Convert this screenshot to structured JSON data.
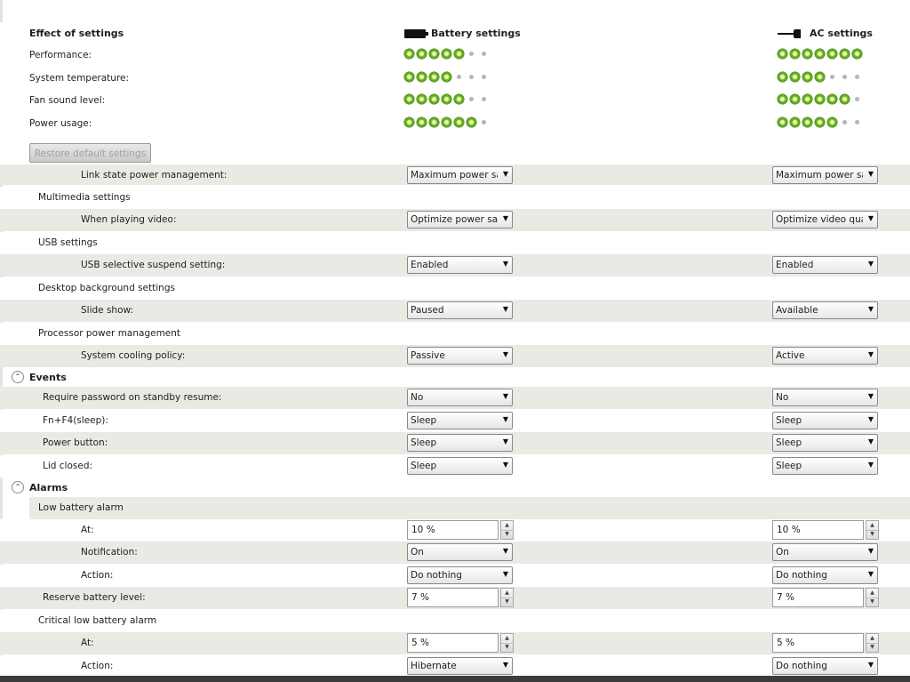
{
  "effect": {
    "title": "Effect of settings",
    "battery_header": "Battery settings",
    "ac_header": "AC settings",
    "rows": [
      {
        "label": "Performance:",
        "battery": {
          "on": 5,
          "total": 7
        },
        "ac": {
          "on": 7,
          "total": 7
        }
      },
      {
        "label": "System temperature:",
        "battery": {
          "on": 4,
          "total": 7
        },
        "ac": {
          "on": 4,
          "total": 7
        }
      },
      {
        "label": "Fan sound level:",
        "battery": {
          "on": 5,
          "total": 7
        },
        "ac": {
          "on": 6,
          "total": 7
        }
      },
      {
        "label": "Power usage:",
        "battery": {
          "on": 6,
          "total": 7
        },
        "ac": {
          "on": 5,
          "total": 7
        }
      }
    ],
    "restore_button": "Restore default settings"
  },
  "list": {
    "partial_row": {
      "label": "Link state power management:",
      "battery": "Maximum power sa",
      "ac": "Maximum power sa"
    },
    "multimedia": {
      "group": "Multimedia settings",
      "item": {
        "label": "When playing video:",
        "battery": "Optimize power sav",
        "ac": "Optimize video qual"
      }
    },
    "usb": {
      "group": "USB settings",
      "item": {
        "label": "USB selective suspend setting:",
        "battery": "Enabled",
        "ac": "Enabled"
      }
    },
    "desktop": {
      "group": "Desktop background settings",
      "item": {
        "label": "Slide show:",
        "battery": "Paused",
        "ac": "Available"
      }
    },
    "processor": {
      "group": "Processor power management",
      "item": {
        "label": "System cooling policy:",
        "battery": "Passive",
        "ac": "Active"
      }
    },
    "events": {
      "title": "Events",
      "items": [
        {
          "label": "Require password on standby resume:",
          "battery": "No",
          "ac": "No"
        },
        {
          "label": "Fn+F4(sleep):",
          "battery": "Sleep",
          "ac": "Sleep"
        },
        {
          "label": "Power button:",
          "battery": "Sleep",
          "ac": "Sleep"
        },
        {
          "label": "Lid closed:",
          "battery": "Sleep",
          "ac": "Sleep"
        }
      ]
    },
    "alarms": {
      "title": "Alarms",
      "low": {
        "group": "Low battery alarm",
        "at": {
          "label": "At:",
          "battery": "10 %",
          "ac": "10 %"
        },
        "notification": {
          "label": "Notification:",
          "battery": "On",
          "ac": "On"
        },
        "action": {
          "label": "Action:",
          "battery": "Do nothing",
          "ac": "Do nothing"
        }
      },
      "reserve": {
        "label": "Reserve battery level:",
        "battery": "7 %",
        "ac": "7 %"
      },
      "critical": {
        "group": "Critical low battery alarm",
        "at": {
          "label": "At:",
          "battery": "5 %",
          "ac": "5 %"
        },
        "action": {
          "label": "Action:",
          "battery": "Hibernate",
          "ac": "Do nothing"
        }
      }
    }
  },
  "icons": {
    "battery": "battery-icon",
    "ac": "plug-icon",
    "collapse": "chevron-up-icon",
    "dropdown": "chevron-down-icon",
    "spinner": "spin-arrows-icon"
  },
  "colors": {
    "dot_on": "#7fc21a",
    "dot_off": "#b6b6b6",
    "row_shade": "#ebe9e4"
  }
}
